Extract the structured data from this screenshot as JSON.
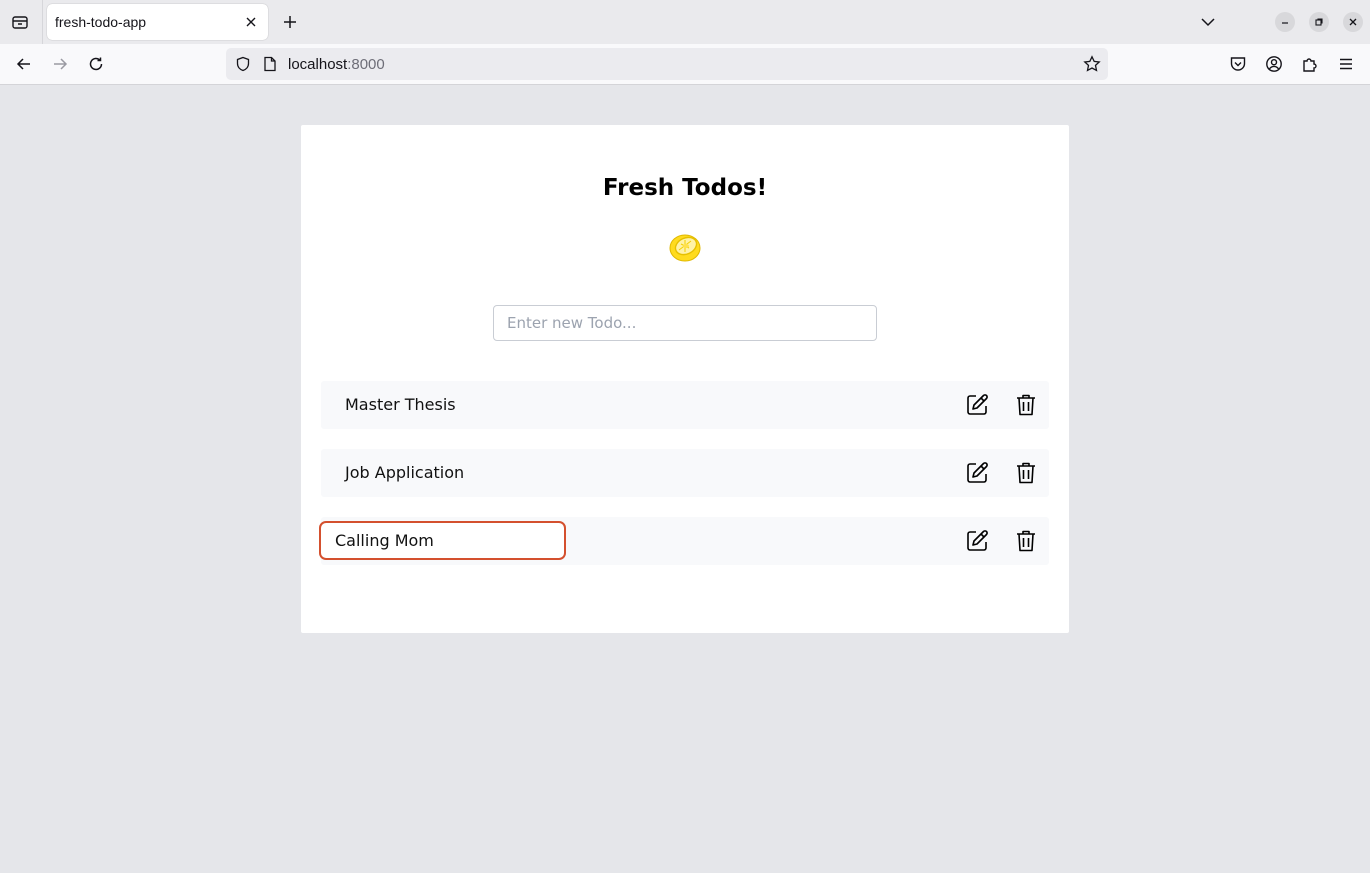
{
  "browser": {
    "tab": {
      "title": "fresh-todo-app"
    },
    "url": {
      "host": "localhost",
      "port": ":8000"
    }
  },
  "app": {
    "title": "Fresh Todos!",
    "logo_icon": "lemon-icon",
    "new_todo": {
      "placeholder": "Enter new Todo...",
      "value": ""
    },
    "todos": [
      {
        "label": "Master Thesis",
        "editing": false
      },
      {
        "label": "Job Application",
        "editing": false
      },
      {
        "label": "Calling Mom",
        "editing": true
      }
    ],
    "row_icons": {
      "edit": "edit-icon",
      "delete": "trash-icon"
    },
    "colors": {
      "accent": "#d4502e",
      "lemon": "#ffdb1e",
      "page_bg": "#e5e6ea"
    }
  }
}
